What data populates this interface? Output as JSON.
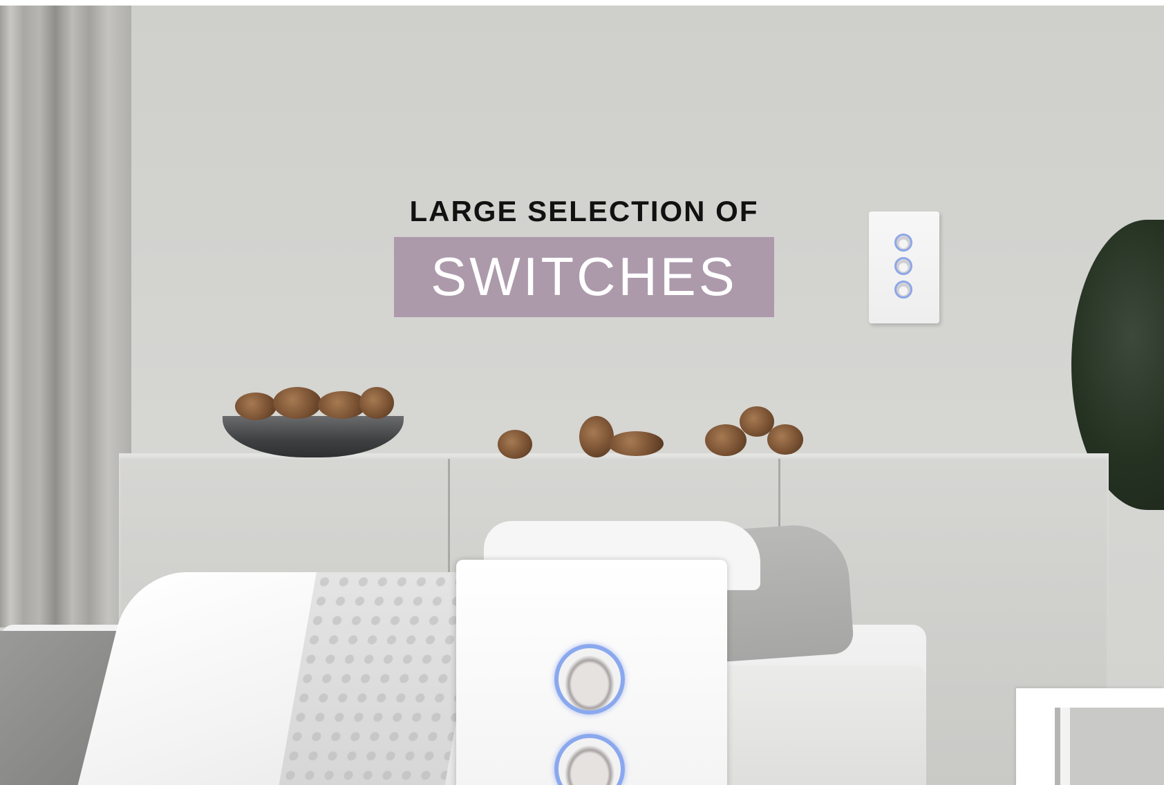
{
  "headline": {
    "small": "LARGE SELECTION OF",
    "big": "SWITCHES"
  },
  "colors": {
    "title_box": "#ac9aab",
    "button_ring": "#8aa8ee"
  },
  "icons": {
    "small_switch": "wall-switch-icon",
    "large_switch": "wall-switch-icon"
  }
}
